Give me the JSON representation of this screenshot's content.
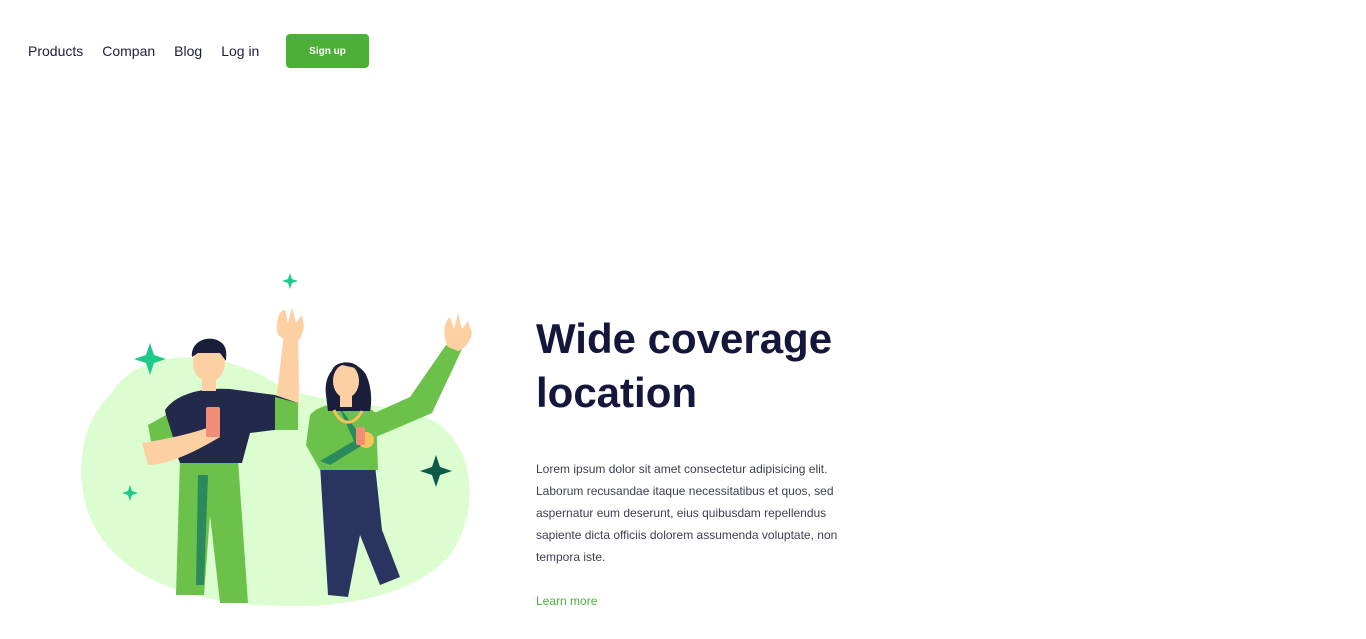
{
  "nav": {
    "links": [
      "Products",
      "Compan",
      "Blog",
      "Log in"
    ],
    "signup_label": "Sign up"
  },
  "hero": {
    "title": "Wide coverage location",
    "body": "Lorem ipsum dolor sit amet consectetur adipisicing elit. Laborum recusandae itaque necessitatibus et quos, sed aspernatur eum deserunt, eius quibusdam repellendus sapiente dicta officiis dolorem assumenda voluptate, non tempora iste.",
    "cta": "Learn more"
  },
  "colors": {
    "brand": "#4caf37",
    "heading": "#14173b",
    "blob": "#dcfdd0",
    "sparkle_light": "#1ec98a",
    "sparkle_dark": "#0c5a48"
  },
  "icons": [
    "sparkle-icon"
  ]
}
